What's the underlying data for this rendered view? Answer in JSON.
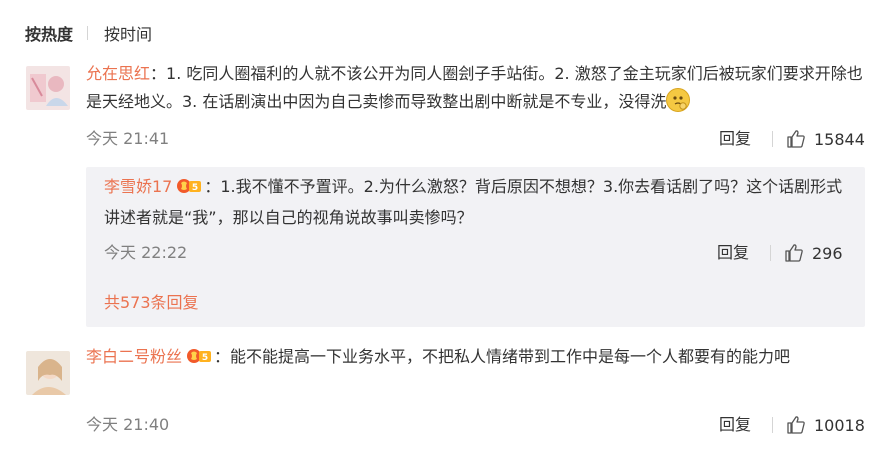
{
  "sort": {
    "hot": "按热度",
    "time": "按时间"
  },
  "comments": [
    {
      "user": "允在思红",
      "text": "：1. 吃同人圈福利的人就不该公开为同人圈刽子手站街。2. 激怒了金主玩家们后被玩家们要求开除也是天经地义。3. 在话剧演出中因为自己卖惨而导致整出剧中断就是不专业，没得洗",
      "time": "今天 21:41",
      "reply_label": "回复",
      "likes": "15844",
      "replies": [
        {
          "user": "李雪娇17",
          "text": "：1.我不懂不予置评。2.为什么激怒？背后原因不想想？3.你去看话剧了吗？这个话剧形式讲述者就是“我”，那以自己的视角说故事叫卖惨吗？",
          "time": "今天 22:22",
          "reply_label": "回复",
          "likes": "296"
        }
      ],
      "more_replies": "共573条回复"
    },
    {
      "user": "李白二号粉丝",
      "text": "：能不能提高一下业务水平，不把私人情绪带到工作中是每一个人都要有的能力吧",
      "time": "今天 21:40",
      "reply_label": "回复",
      "likes": "10018"
    }
  ],
  "colors": {
    "username": "#eb7350",
    "meta": "#808080",
    "reply_bg": "#f2f2f5"
  },
  "icons": {
    "like": "thumbs-up-icon",
    "badge": "vip-badge-icon",
    "emoji": "thinking-emoji-icon"
  }
}
